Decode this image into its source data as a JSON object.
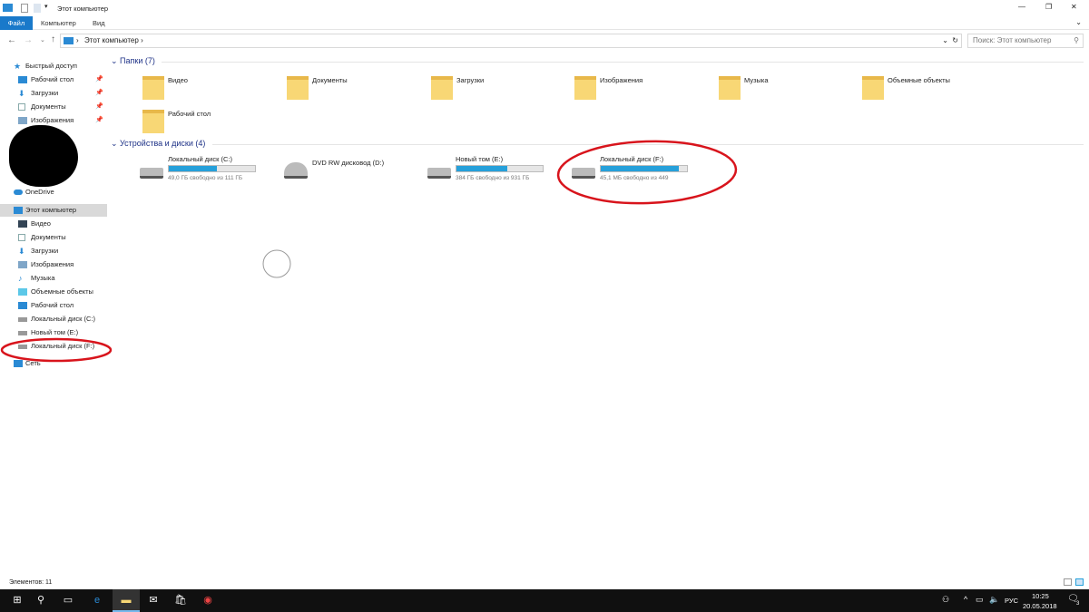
{
  "window": {
    "title": "Этот компьютер",
    "minimize": "—",
    "maximize": "❐",
    "close": "✕"
  },
  "ribbon": {
    "tabs": [
      "Файл",
      "Компьютер",
      "Вид"
    ]
  },
  "address": {
    "path": "Этот компьютер",
    "search_placeholder": "Поиск: Этот компьютер"
  },
  "nav": {
    "quick_access": "Быстрый доступ",
    "quick_items": [
      "Рабочий стол",
      "Загрузки",
      "Документы",
      "Изображения"
    ],
    "onedrive": "OneDrive",
    "this_pc": "Этот компьютер",
    "pc_items": [
      "Видео",
      "Документы",
      "Загрузки",
      "Изображения",
      "Музыка",
      "Объемные объекты",
      "Рабочий стол",
      "Локальный диск (C:)",
      "Новый том (E:)",
      "Локальный диск (F:)"
    ],
    "network": "Сеть"
  },
  "folders": {
    "header": "Папки (7)",
    "items": [
      "Видео",
      "Документы",
      "Загрузки",
      "Изображения",
      "Музыка",
      "Объемные объекты",
      "Рабочий стол"
    ]
  },
  "drives": {
    "header": "Устройства и диски (4)",
    "items": [
      {
        "name": "Локальный диск (C:)",
        "free": "49,0 ГБ свободно из 111 ГБ",
        "used_pct": 56
      },
      {
        "name": "DVD RW дисковод (D:)",
        "free": "",
        "used_pct": null
      },
      {
        "name": "Новый том (E:)",
        "free": "384 ГБ свободно из 931 ГБ",
        "used_pct": 59
      },
      {
        "name": "Локальный диск (F:)",
        "free": "45,1 МБ свободно из 449",
        "used_pct": 90
      }
    ]
  },
  "status": {
    "count": "Элементов: 11"
  },
  "taskbar": {
    "lang": "РУС",
    "time": "10:25",
    "date": "20.05.2018",
    "notif_count": "3"
  },
  "colors": {
    "accent": "#1979ca",
    "bar": "#26a0da",
    "annotation": "#d8141c"
  }
}
